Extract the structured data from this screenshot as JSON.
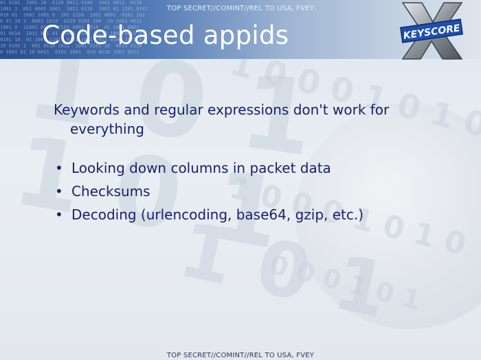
{
  "classification": {
    "top": "TOP SECRET//COMINT//REL TO USA, FVEY",
    "bottom": "TOP SECRET//COMINT//REL TO USA, FVEY"
  },
  "slide": {
    "title": "Code-based appids",
    "intro": "Keywords and regular expressions don't work for everything",
    "bullets": [
      "Looking down columns in packet data",
      "Checksums",
      "Decoding (urlencoding, base64, gzip, etc.)"
    ]
  },
  "logo": {
    "text": "KEYSCORE",
    "letter": "X"
  },
  "colors": {
    "title": "#ffffff",
    "body_text": "#17226a",
    "header_dark": "#2a4d8f"
  }
}
